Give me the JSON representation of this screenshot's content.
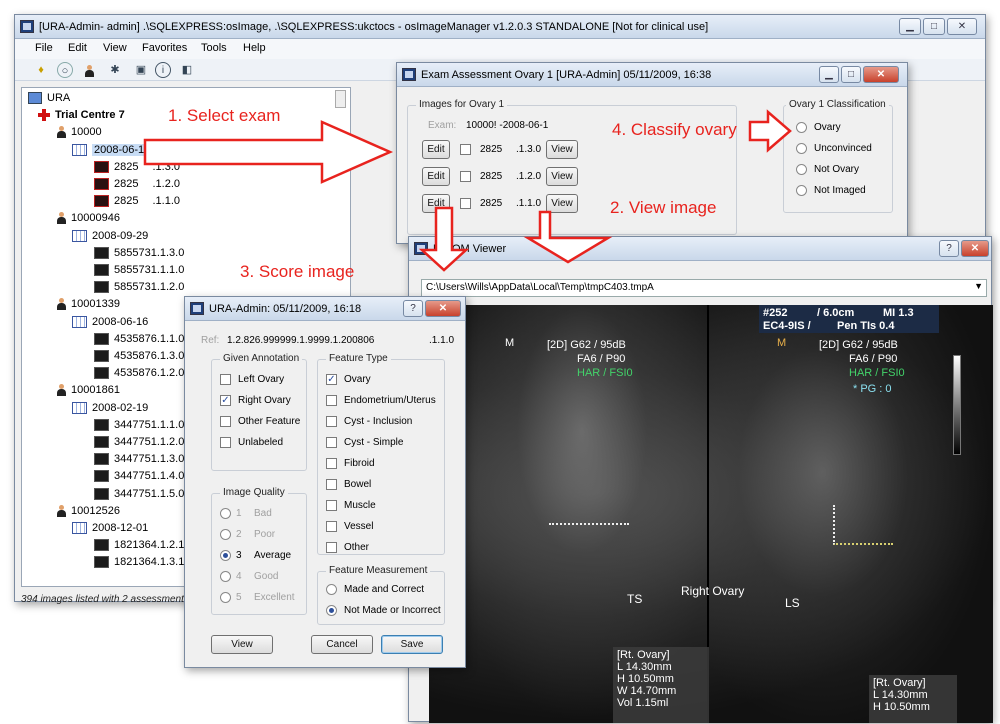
{
  "main_window": {
    "title": "[URA-Admin- admin] .\\SQLEXPRESS:osImage, .\\SQLEXPRESS:ukctocs - osImageManager v1.2.0.3 STANDALONE  [Not for clinical use]",
    "menu": [
      "File",
      "Edit",
      "View",
      "Favorites",
      "Tools",
      "Help"
    ],
    "status": "394 images listed with 2 assessments",
    "tree": {
      "root": "URA",
      "centre": "Trial Centre 7",
      "patients": [
        {
          "id": "10000",
          "exam": "2008-06-1",
          "images": [
            {
              "a": "2825",
              "b": ".1.3.0"
            },
            {
              "a": "2825",
              "b": ".1.2.0"
            },
            {
              "a": "2825",
              "b": ".1.1.0"
            }
          ]
        },
        {
          "id": "10000946",
          "exam": "2008-09-29",
          "images": [
            {
              "a": "5855731.1.3.0"
            },
            {
              "a": "5855731.1.1.0"
            },
            {
              "a": "5855731.1.2.0"
            }
          ]
        },
        {
          "id": "10001339",
          "exam": "2008-06-16",
          "images": [
            {
              "a": "4535876.1.1.0"
            },
            {
              "a": "4535876.1.3.0"
            },
            {
              "a": "4535876.1.2.0"
            }
          ]
        },
        {
          "id": "10001861",
          "exam": "2008-02-19",
          "images": [
            {
              "a": "3447751.1.1.0"
            },
            {
              "a": "3447751.1.2.0"
            },
            {
              "a": "3447751.1.3.0"
            },
            {
              "a": "3447751.1.4.0"
            },
            {
              "a": "3447751.1.5.0"
            }
          ]
        },
        {
          "id": "10012526",
          "exam": "2008-12-01",
          "images": [
            {
              "a": "1821364.1.2.1"
            },
            {
              "a": "1821364.1.3.1"
            }
          ]
        }
      ]
    }
  },
  "exam_window": {
    "title": "Exam Assessment Ovary 1 [URA-Admin] 05/11/2009, 16:38",
    "images_group": "Images for Ovary 1",
    "exam_label": "Exam:",
    "exam_value": "10000! -2008-06-1",
    "rows": [
      {
        "edit": "Edit",
        "id": "2825",
        "code": ".1.3.0",
        "view": "View"
      },
      {
        "edit": "Edit",
        "id": "2825",
        "code": ".1.2.0",
        "view": "View"
      },
      {
        "edit": "Edit",
        "id": "2825",
        "code": ".1.1.0",
        "view": "View"
      }
    ],
    "classification_group": "Ovary 1 Classification",
    "classification_options": [
      "Ovary",
      "Unconvinced",
      "Not Ovary",
      "Not Imaged"
    ]
  },
  "dicom_window": {
    "title": "DICOM Viewer",
    "path": "C:\\Users\\Wills\\AppData\\Local\\Temp\\tmpC403.tmpA",
    "header_tl": "#252",
    "header_depth": "/ 6.0cm",
    "header_mi": "MI 1.3",
    "header_probe": "EC4-9IS /",
    "header_tis": "Pen TIs 0.4",
    "left": {
      "mode": "[2D] G62 / 95dB",
      "fa": "FA6 / P90",
      "har": "HAR / FSI0"
    },
    "right": {
      "mode": "[2D] G62 / 95dB",
      "fa": "FA6 / P90",
      "har": "HAR / FSI0",
      "pg": "* PG : 0"
    },
    "label_ts": "TS",
    "label_ovary": "Right Ovary",
    "label_ls": "LS",
    "meas_left": [
      "[Rt. Ovary]",
      "L  14.30mm",
      "H  10.50mm",
      "W  14.70mm",
      "Vol 1.15ml"
    ],
    "meas_right": [
      "[Rt. Ovary]",
      "L  14.30mm",
      "H  10.50mm"
    ],
    "marker_m": "M"
  },
  "score_window": {
    "title": "URA-Admin: 05/11/2009, 16:18",
    "ref_label": "Ref:",
    "ref_value": "1.2.826.999999.1.9999.1.200806",
    "ref_suffix": ".1.1.0",
    "given_annotation": {
      "label": "Given Annotation",
      "items": [
        {
          "text": "Left Ovary",
          "checked": false
        },
        {
          "text": "Right Ovary",
          "checked": true
        },
        {
          "text": "Other Feature",
          "checked": false
        },
        {
          "text": "Unlabeled",
          "checked": false
        }
      ]
    },
    "image_quality": {
      "label": "Image Quality",
      "items": [
        {
          "num": "1",
          "text": "Bad"
        },
        {
          "num": "2",
          "text": "Poor"
        },
        {
          "num": "3",
          "text": "Average",
          "selected": true
        },
        {
          "num": "4",
          "text": "Good"
        },
        {
          "num": "5",
          "text": "Excellent"
        }
      ]
    },
    "feature_type": {
      "label": "Feature Type",
      "items": [
        {
          "text": "Ovary",
          "checked": true
        },
        {
          "text": "Endometrium/Uterus"
        },
        {
          "text": "Cyst - Inclusion"
        },
        {
          "text": "Cyst - Simple"
        },
        {
          "text": "Fibroid"
        },
        {
          "text": "Bowel"
        },
        {
          "text": "Muscle"
        },
        {
          "text": "Vessel"
        },
        {
          "text": "Other"
        }
      ]
    },
    "feature_measurement": {
      "label": "Feature Measurement",
      "items": [
        {
          "text": "Made and Correct"
        },
        {
          "text": "Not Made or Incorrect",
          "selected": true
        }
      ]
    },
    "view_btn": "View",
    "cancel_btn": "Cancel",
    "save_btn": "Save"
  },
  "annotations": {
    "step1": "1. Select exam",
    "step2": "2. View image",
    "step3": "3. Score image",
    "step4": "4. Classify ovary"
  },
  "colors": {
    "annotation_red": "#e8231e",
    "us_green": "#43d36a",
    "titlebar": "#c9d8ea"
  }
}
